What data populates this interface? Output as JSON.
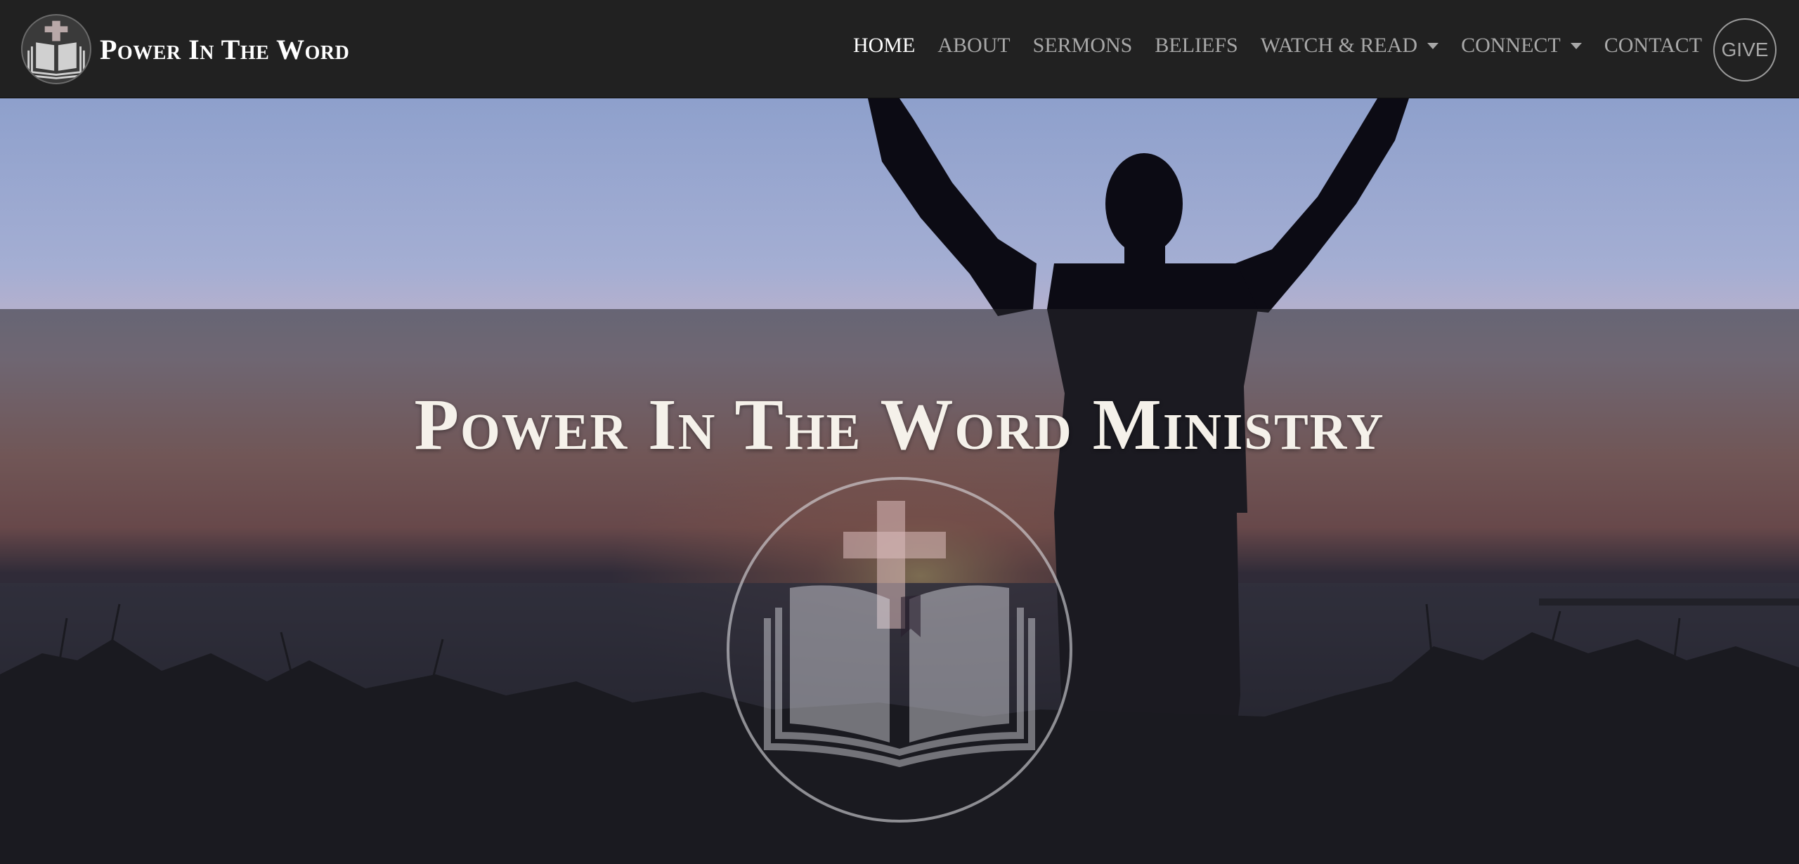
{
  "navbar": {
    "brand_title": "Power In The Word",
    "menu": [
      {
        "label": "HOME",
        "active": true,
        "dropdown": false
      },
      {
        "label": "ABOUT",
        "active": false,
        "dropdown": false
      },
      {
        "label": "SERMONS",
        "active": false,
        "dropdown": false
      },
      {
        "label": "BELIEFS",
        "active": false,
        "dropdown": false
      },
      {
        "label": "WATCH & READ",
        "active": false,
        "dropdown": true
      },
      {
        "label": "CONNECT",
        "active": false,
        "dropdown": true
      },
      {
        "label": "CONTACT",
        "active": false,
        "dropdown": false
      }
    ],
    "give_label": "GIVE"
  },
  "hero": {
    "title": "Power In The Word Ministry",
    "background_image": "silhouette-arms-raised-sunset-ocean",
    "logo_icon": "cross-bible-icon"
  },
  "colors": {
    "navbar_bg": "#212121",
    "nav_text": "#a8a8a8",
    "nav_active": "#ffffff",
    "hero_title": "#f5f1ea"
  }
}
